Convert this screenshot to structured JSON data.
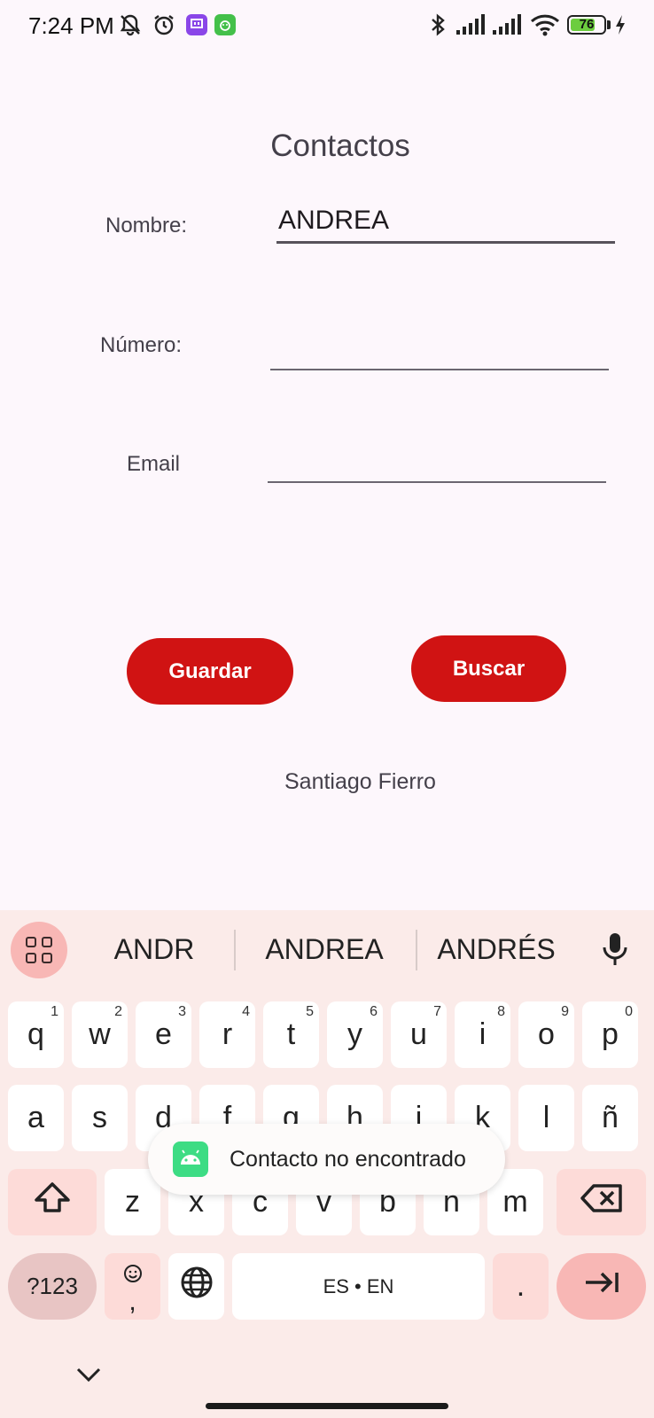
{
  "status_bar": {
    "time": "7:24 PM",
    "icons": [
      "silent-bell-icon",
      "alarm-icon",
      "twitch-icon",
      "app-icon",
      "bluetooth-icon",
      "signal-icon",
      "signal-icon",
      "wifi-icon",
      "battery-icon",
      "charging-icon"
    ],
    "battery_level": "76",
    "battery_fraction": 0.76
  },
  "form": {
    "title": "Contactos",
    "nombre_label": "Nombre:",
    "nombre_value": "ANDREA",
    "numero_label": "Número:",
    "numero_value": "",
    "email_label": "Email",
    "email_value": ""
  },
  "buttons": {
    "guardar": "Guardar",
    "buscar": "Buscar"
  },
  "author": "Santiago Fierro",
  "keyboard": {
    "suggestions": [
      "ANDR",
      "ANDREA",
      "ANDRÉS"
    ],
    "row1": [
      {
        "k": "q",
        "h": "1"
      },
      {
        "k": "w",
        "h": "2"
      },
      {
        "k": "e",
        "h": "3"
      },
      {
        "k": "r",
        "h": "4"
      },
      {
        "k": "t",
        "h": "5"
      },
      {
        "k": "y",
        "h": "6"
      },
      {
        "k": "u",
        "h": "7"
      },
      {
        "k": "i",
        "h": "8"
      },
      {
        "k": "o",
        "h": "9"
      },
      {
        "k": "p",
        "h": "0"
      }
    ],
    "row2": [
      "a",
      "s",
      "d",
      "f",
      "g",
      "h",
      "j",
      "k",
      "l",
      "ñ"
    ],
    "row3": [
      "z",
      "x",
      "c",
      "v",
      "b",
      "n",
      "m"
    ],
    "symbols_label": "?123",
    "emoji_comma": ",",
    "space_label": "ES • EN",
    "period": "."
  },
  "toast": {
    "message": "Contacto no encontrado"
  },
  "colors": {
    "button_red": "#d01313",
    "background": "#fdf7fc",
    "keyboard_bg": "#fbebe9",
    "accent_pink": "#f8b7b5"
  }
}
